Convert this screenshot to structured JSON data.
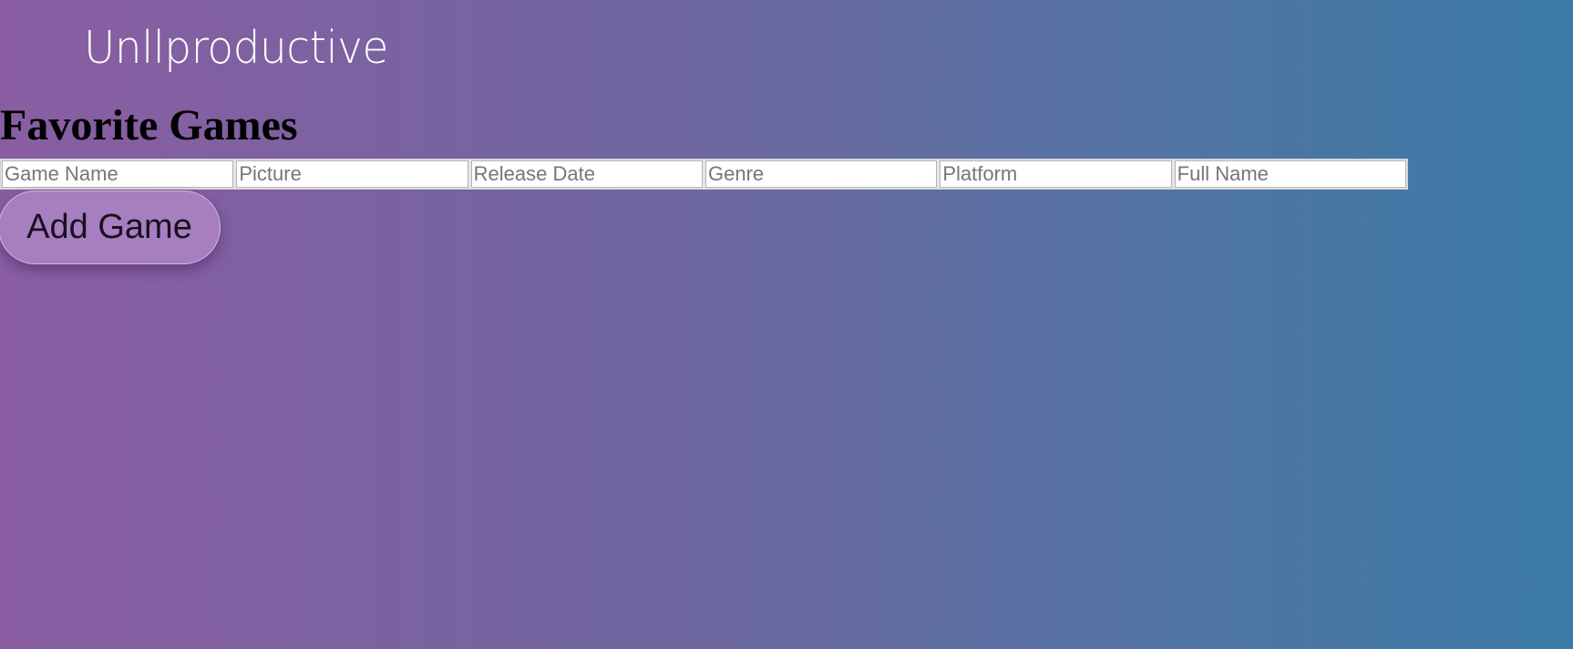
{
  "header": {
    "logo_text": "Unllproductive"
  },
  "main": {
    "title": "Favorite Games",
    "form": {
      "fields": [
        {
          "placeholder": "Game Name",
          "value": ""
        },
        {
          "placeholder": "Picture",
          "value": ""
        },
        {
          "placeholder": "Release Date",
          "value": ""
        },
        {
          "placeholder": "Genre",
          "value": ""
        },
        {
          "placeholder": "Platform",
          "value": ""
        },
        {
          "placeholder": "Full Name",
          "value": ""
        }
      ],
      "add_button_label": "Add Game"
    }
  },
  "colors": {
    "gradient_start": "#8a5da2",
    "gradient_end": "#3c7aa8",
    "button_bg": "#a77fc0"
  }
}
